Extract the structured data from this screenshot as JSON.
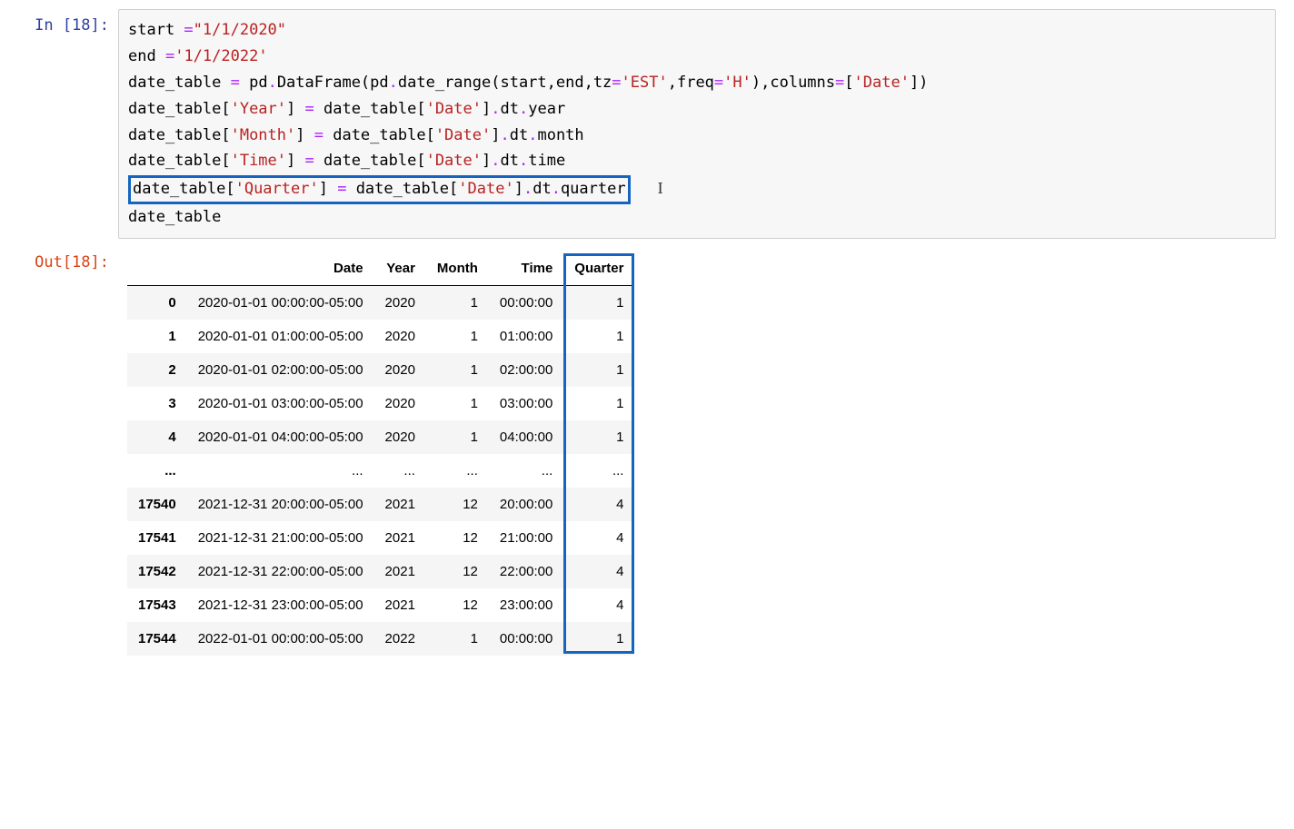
{
  "in_prompt": "In [18]:",
  "out_prompt": "Out[18]:",
  "code": {
    "l1a": "start ",
    "l1op": "=",
    "l1b": "\"1/1/2020\"",
    "l2a": "end ",
    "l2op": "=",
    "l2b": "'1/1/2022'",
    "l3a": "date_table ",
    "l3op": "=",
    "l3b": " pd",
    "l3dot1": ".",
    "l3c": "DataFrame(pd",
    "l3dot2": ".",
    "l3d": "date_range(start,end,tz",
    "l3eq2": "=",
    "l3e": "'EST'",
    "l3f": ",freq",
    "l3eq3": "=",
    "l3g": "'H'",
    "l3h": "),columns",
    "l3eq4": "=",
    "l3i": "[",
    "l3j": "'Date'",
    "l3k": "])",
    "l4a": "date_table[",
    "l4b": "'Year'",
    "l4c": "] ",
    "l4op": "=",
    "l4d": " date_table[",
    "l4e": "'Date'",
    "l4f": "]",
    "l4dot": ".",
    "l4g": "dt",
    "l4dot2": ".",
    "l4h": "year",
    "l5a": "date_table[",
    "l5b": "'Month'",
    "l5c": "] ",
    "l5op": "=",
    "l5d": " date_table[",
    "l5e": "'Date'",
    "l5f": "]",
    "l5dot": ".",
    "l5g": "dt",
    "l5dot2": ".",
    "l5h": "month",
    "l6a": "date_table[",
    "l6b": "'Time'",
    "l6c": "] ",
    "l6op": "=",
    "l6d": " date_table[",
    "l6e": "'Date'",
    "l6f": "]",
    "l6dot": ".",
    "l6g": "dt",
    "l6dot2": ".",
    "l6h": "time",
    "l7a": "date_table[",
    "l7b": "'Quarter'",
    "l7c": "] ",
    "l7op": "=",
    "l7d": " date_table[",
    "l7e": "'Date'",
    "l7f": "]",
    "l7dot": ".",
    "l7g": "dt",
    "l7dot2": ".",
    "l7h": "quarter",
    "l8": "date_table"
  },
  "columns": {
    "c0": "",
    "c1": "Date",
    "c2": "Year",
    "c3": "Month",
    "c4": "Time",
    "c5": "Quarter"
  },
  "rows": [
    {
      "idx": "0",
      "date": "2020-01-01 00:00:00-05:00",
      "year": "2020",
      "month": "1",
      "time": "00:00:00",
      "quarter": "1"
    },
    {
      "idx": "1",
      "date": "2020-01-01 01:00:00-05:00",
      "year": "2020",
      "month": "1",
      "time": "01:00:00",
      "quarter": "1"
    },
    {
      "idx": "2",
      "date": "2020-01-01 02:00:00-05:00",
      "year": "2020",
      "month": "1",
      "time": "02:00:00",
      "quarter": "1"
    },
    {
      "idx": "3",
      "date": "2020-01-01 03:00:00-05:00",
      "year": "2020",
      "month": "1",
      "time": "03:00:00",
      "quarter": "1"
    },
    {
      "idx": "4",
      "date": "2020-01-01 04:00:00-05:00",
      "year": "2020",
      "month": "1",
      "time": "04:00:00",
      "quarter": "1"
    },
    {
      "idx": "...",
      "date": "...",
      "year": "...",
      "month": "...",
      "time": "...",
      "quarter": "..."
    },
    {
      "idx": "17540",
      "date": "2021-12-31 20:00:00-05:00",
      "year": "2021",
      "month": "12",
      "time": "20:00:00",
      "quarter": "4"
    },
    {
      "idx": "17541",
      "date": "2021-12-31 21:00:00-05:00",
      "year": "2021",
      "month": "12",
      "time": "21:00:00",
      "quarter": "4"
    },
    {
      "idx": "17542",
      "date": "2021-12-31 22:00:00-05:00",
      "year": "2021",
      "month": "12",
      "time": "22:00:00",
      "quarter": "4"
    },
    {
      "idx": "17543",
      "date": "2021-12-31 23:00:00-05:00",
      "year": "2021",
      "month": "12",
      "time": "23:00:00",
      "quarter": "4"
    },
    {
      "idx": "17544",
      "date": "2022-01-01 00:00:00-05:00",
      "year": "2022",
      "month": "1",
      "time": "00:00:00",
      "quarter": "1"
    }
  ]
}
